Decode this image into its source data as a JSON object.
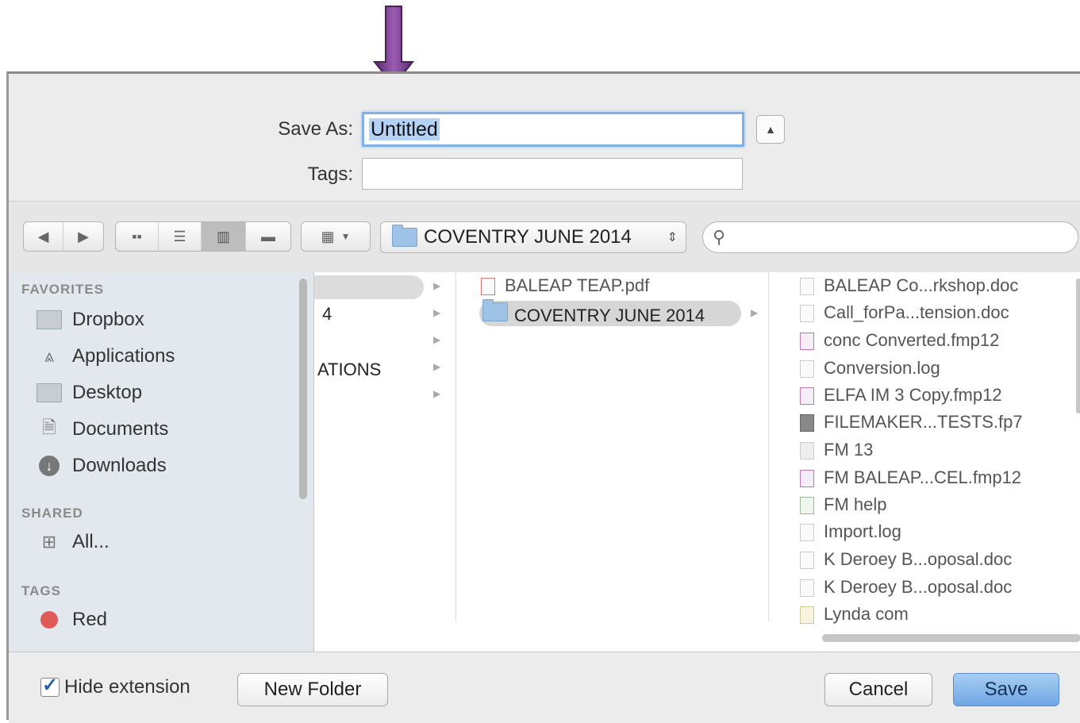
{
  "dialog": {
    "save_as_label": "Save As:",
    "save_as_value": "Untitled",
    "tags_label": "Tags:",
    "tags_value": ""
  },
  "toolbar": {
    "back_icon": "back-arrow",
    "forward_icon": "forward-arrow",
    "view_modes": [
      "icon-view",
      "list-view",
      "column-view",
      "coverflow-view"
    ],
    "active_view": "column-view",
    "arrange_icon": "arrange-grid",
    "location": "COVENTRY JUNE 2014",
    "search_placeholder": ""
  },
  "sidebar": {
    "favorites_header": "FAVORITES",
    "favorites": [
      {
        "label": "Dropbox",
        "icon": "folder-icon"
      },
      {
        "label": "Applications",
        "icon": "applications-icon"
      },
      {
        "label": "Desktop",
        "icon": "desktop-icon"
      },
      {
        "label": "Documents",
        "icon": "documents-icon"
      },
      {
        "label": "Downloads",
        "icon": "downloads-icon"
      }
    ],
    "shared_header": "SHARED",
    "shared": [
      {
        "label": "All...",
        "icon": "network-icon"
      }
    ],
    "tags_header": "TAGS",
    "tags": [
      {
        "label": "Red",
        "color": "#e05a5a"
      }
    ]
  },
  "columns": {
    "col1": [
      "4",
      "ATIONS"
    ],
    "col2": [
      "BALEAP TEAP.pdf",
      "COVENTRY JUNE 2014"
    ],
    "col3": [
      "BALEAP Co...rkshop.doc",
      "Call_forPa...tension.doc",
      "conc Converted.fmp12",
      "Conversion.log",
      "ELFA IM 3 Copy.fmp12",
      "FILEMAKER...TESTS.fp7",
      "FM 13",
      "FM BALEAP...CEL.fmp12",
      "FM help",
      "Import.log",
      "K Deroey B...oposal.doc",
      "K Deroey B...oposal.doc",
      "Lynda com"
    ]
  },
  "footer": {
    "hide_extension_label": "Hide extension",
    "hide_extension_checked": true,
    "new_folder_label": "New Folder",
    "cancel_label": "Cancel",
    "save_label": "Save"
  },
  "colors": {
    "accent": "#6fa6e3",
    "arrow": "#7b3f8f"
  }
}
